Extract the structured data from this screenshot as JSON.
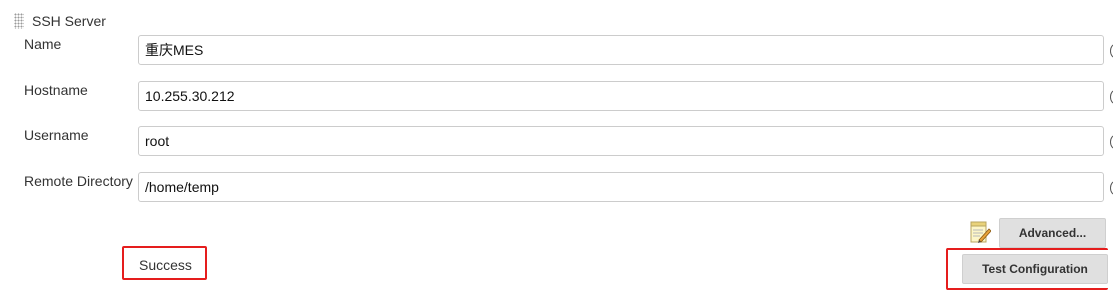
{
  "section": {
    "title": "SSH Server"
  },
  "fields": {
    "name": {
      "label": "Name",
      "value": "重庆MES"
    },
    "hostname": {
      "label": "Hostname",
      "value": "10.255.30.212"
    },
    "username": {
      "label": "Username",
      "value": "root"
    },
    "remote_directory": {
      "label": "Remote Directory",
      "value": "/home/temp"
    }
  },
  "buttons": {
    "advanced_label": "Advanced...",
    "test_label": "Test Configuration"
  },
  "status": {
    "message": "Success"
  },
  "colors": {
    "highlight": "#e51d1d",
    "button_bg": "#e0e0e0",
    "input_border": "#cccccc"
  },
  "icons": {
    "drag_handle": "drag-handle-icon",
    "notepad": "notepad-pencil-icon",
    "help": "help-icon"
  }
}
